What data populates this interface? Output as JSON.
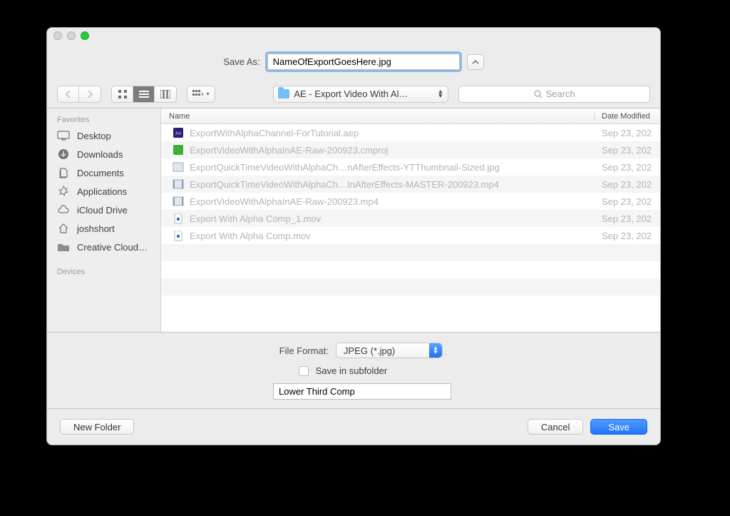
{
  "saveas": {
    "label": "Save As:",
    "value": "NameOfExportGoesHere.jpg"
  },
  "toolbar": {
    "folder": "AE - Export Video With Al…",
    "search_placeholder": "Search"
  },
  "sidebar": {
    "sections": [
      {
        "title": "Favorites",
        "items": [
          "Desktop",
          "Downloads",
          "Documents",
          "Applications",
          "iCloud Drive",
          "joshshort",
          "Creative Cloud…"
        ]
      },
      {
        "title": "Devices",
        "items": []
      }
    ]
  },
  "columns": {
    "name": "Name",
    "date": "Date Modified"
  },
  "files": [
    {
      "name": "ExportWithAlphaChannel-ForTutorial.aep",
      "date": "Sep 23, 202",
      "type": "aep"
    },
    {
      "name": "ExportVideoWithAlphaInAE-Raw-200923.cmproj",
      "date": "Sep 23, 202",
      "type": "cmproj"
    },
    {
      "name": "ExportQuickTimeVideoWithAlphaCh…nAfterEffects-YTThumbnail-Sized.jpg",
      "date": "Sep 23, 202",
      "type": "jpg"
    },
    {
      "name": "ExportQuickTimeVideoWithAlphaCh…InAfterEffects-MASTER-200923.mp4",
      "date": "Sep 23, 202",
      "type": "mp4"
    },
    {
      "name": "ExportVideoWithAlphaInAE-Raw-200923.mp4",
      "date": "Sep 23, 202",
      "type": "mp4"
    },
    {
      "name": "Export With Alpha Comp_1.mov",
      "date": "Sep 23, 202",
      "type": "mov"
    },
    {
      "name": "Export With Alpha Comp.mov",
      "date": "Sep 23, 202",
      "type": "mov"
    }
  ],
  "format": {
    "label": "File Format:",
    "value": "JPEG (*.jpg)"
  },
  "subfolder": {
    "checkbox_label": "Save in subfolder",
    "value": "Lower Third Comp"
  },
  "buttons": {
    "new_folder": "New Folder",
    "cancel": "Cancel",
    "save": "Save"
  }
}
